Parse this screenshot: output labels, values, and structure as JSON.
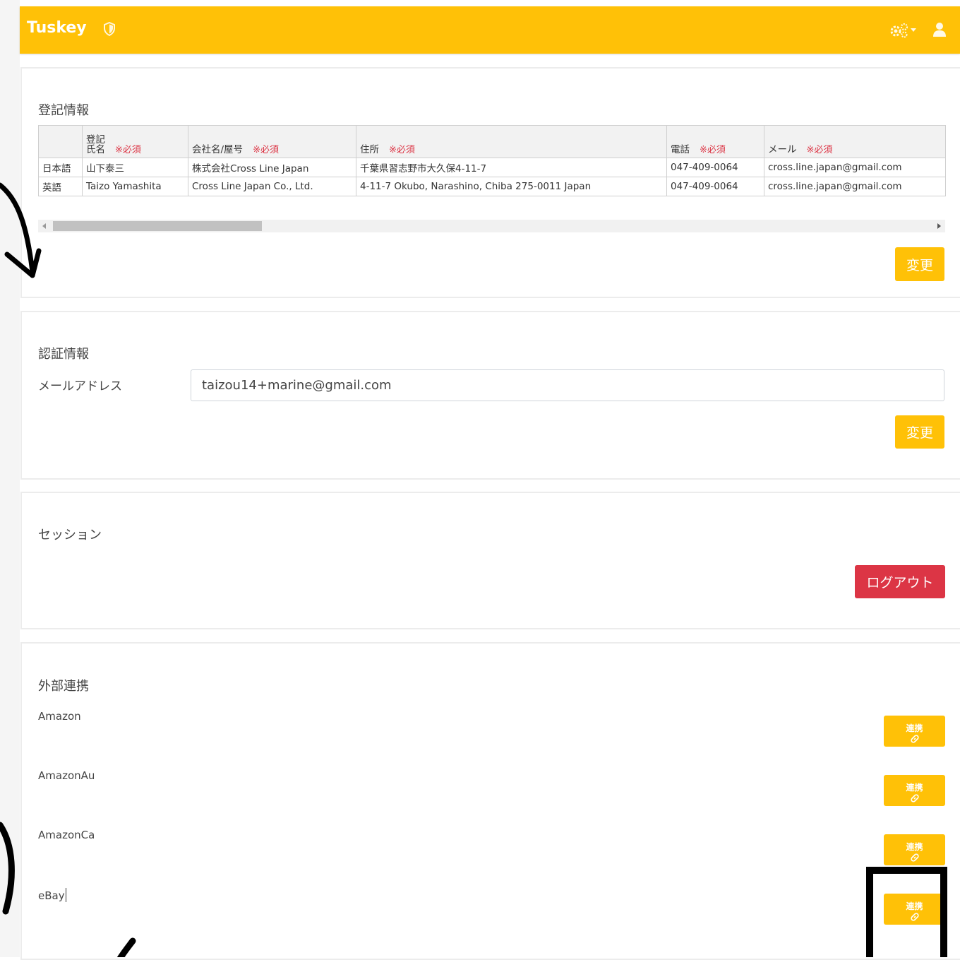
{
  "app": {
    "brand": "Tuskey"
  },
  "icons": {
    "shield": "shield-icon",
    "gear": "gears-icon",
    "caret": "caret-down-icon",
    "user": "user-icon",
    "link": "link-icon"
  },
  "colors": {
    "primary": "#ffc107",
    "danger": "#dc3545",
    "required": "#dc3545"
  },
  "registration": {
    "title": "登記情報",
    "required_mark": "※必須",
    "headers": {
      "lang": "",
      "name_line1": "登記",
      "name_line2": "氏名",
      "company": "会社名/屋号",
      "address": "住所",
      "phone": "電話",
      "email": "メール"
    },
    "rows": [
      {
        "lang": "日本語",
        "name": "山下泰三",
        "company": "株式会社Cross Line Japan",
        "address": "千葉県習志野市大久保4-11-7",
        "phone": "047-409-0064",
        "email": "cross.line.japan@gmail.com"
      },
      {
        "lang": "英語",
        "name": "Taizo Yamashita",
        "company": "Cross Line Japan Co., Ltd.",
        "address": "4-11-7 Okubo, Narashino, Chiba 275-0011 Japan",
        "phone": "047-409-0064",
        "email": "cross.line.japan@gmail.com"
      }
    ],
    "change_label": "変更"
  },
  "auth": {
    "title": "認証情報",
    "email_label": "メールアドレス",
    "email_value": "taizou14+marine@gmail.com",
    "change_label": "変更"
  },
  "session": {
    "title": "セッション",
    "logout_label": "ログアウト"
  },
  "integrations": {
    "title": "外部連携",
    "button_label": "連携",
    "services": [
      "Amazon",
      "AmazonAu",
      "AmazonCa",
      "eBay"
    ]
  }
}
